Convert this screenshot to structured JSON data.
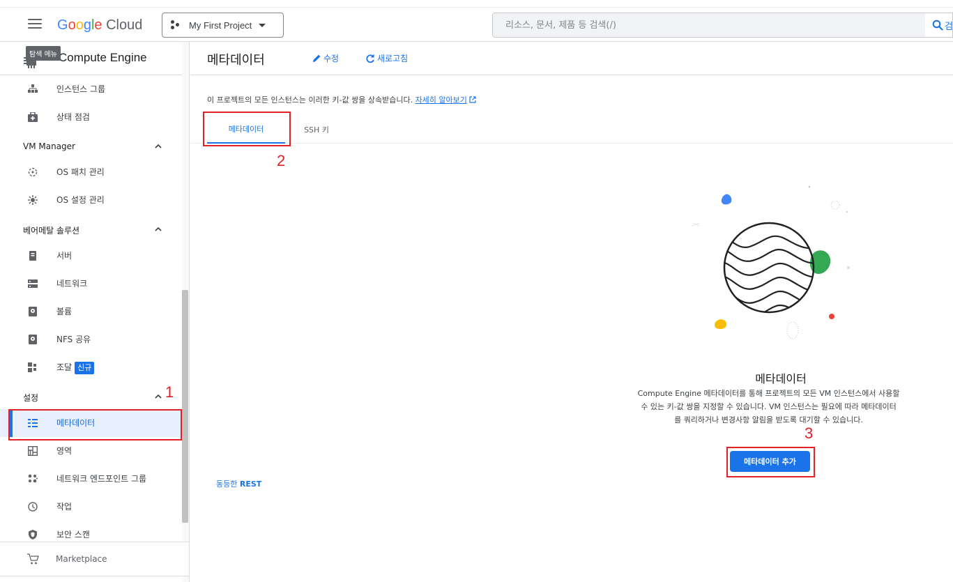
{
  "header": {
    "logo_google": "Google",
    "logo_cloud": "Cloud",
    "project_name": "My First Project",
    "search_placeholder": "리소스, 문서, 제품 등 검색(/)",
    "search_button_label": "검"
  },
  "sidebar": {
    "product_title": "Compute Engine",
    "tooltip": "탐색 메뉴",
    "items_top": [
      {
        "label": "인스턴스 그룹",
        "icon": "instance-group-icon"
      },
      {
        "label": "상태 점검",
        "icon": "health-check-icon"
      }
    ],
    "section_vm_manager": "VM Manager",
    "items_vm_manager": [
      {
        "label": "OS 패치 관리",
        "icon": "os-patch-icon"
      },
      {
        "label": "OS 설정 관리",
        "icon": "os-config-icon"
      }
    ],
    "section_bare_metal": "베어메탈 솔루션",
    "items_bare_metal": [
      {
        "label": "서버",
        "icon": "server-icon"
      },
      {
        "label": "네트워크",
        "icon": "network-icon"
      },
      {
        "label": "볼륨",
        "icon": "volume-icon"
      },
      {
        "label": "NFS 공유",
        "icon": "nfs-share-icon"
      },
      {
        "label": "조달",
        "icon": "procurement-icon",
        "badge": "신규"
      }
    ],
    "section_settings": "설정",
    "items_settings": [
      {
        "label": "메타데이터",
        "icon": "metadata-icon",
        "active": true
      },
      {
        "label": "영역",
        "icon": "zones-icon"
      },
      {
        "label": "네트워크 엔드포인트 그룹",
        "icon": "endpoint-group-icon"
      },
      {
        "label": "작업",
        "icon": "operations-icon"
      },
      {
        "label": "보안 스캔",
        "icon": "security-scan-icon"
      }
    ],
    "footer_label": "Marketplace"
  },
  "main": {
    "title": "메타데이터",
    "edit_label": "수정",
    "refresh_label": "새로고침",
    "description": "이 프로젝트의 모든 인스턴스는 이러한 키-값 쌍을 상속받습니다.",
    "learn_more": "자세히 알아보기",
    "tabs": [
      {
        "label": "메타데이터",
        "active": true
      },
      {
        "label": "SSH 키",
        "active": false
      }
    ],
    "empty_state": {
      "title": "메타데이터",
      "line1": "Compute Engine 메타데이터를 통해 프로젝트의 모든 VM 인스턴스에서 사용할",
      "line2": "수 있는 키-값 쌍을 지정할 수 있습니다. VM 인스턴스는 필요에 따라 메타데이터",
      "line3": "를 쿼리하거나 변경사항 알림을 받도록 대기할 수 있습니다.",
      "button": "메타데이터 추가"
    },
    "rest_prefix": "동등한",
    "rest_label": "REST"
  },
  "annotations": {
    "n1": "1",
    "n2": "2",
    "n3": "3",
    "color": "#e1202a"
  },
  "colors": {
    "accent": "#1a73e8",
    "google_blue": "#4285f4",
    "google_red": "#ea4335",
    "google_yellow": "#fbbc04",
    "google_green": "#34a853"
  }
}
